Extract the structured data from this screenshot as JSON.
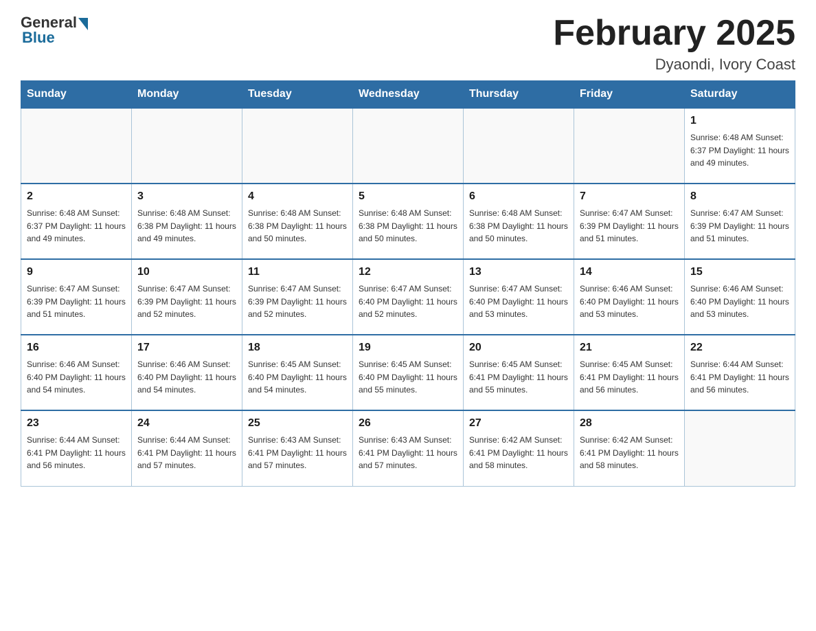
{
  "header": {
    "logo_general": "General",
    "logo_blue": "Blue",
    "title": "February 2025",
    "subtitle": "Dyaondi, Ivory Coast"
  },
  "days_of_week": [
    "Sunday",
    "Monday",
    "Tuesday",
    "Wednesday",
    "Thursday",
    "Friday",
    "Saturday"
  ],
  "weeks": [
    [
      {
        "day": "",
        "info": ""
      },
      {
        "day": "",
        "info": ""
      },
      {
        "day": "",
        "info": ""
      },
      {
        "day": "",
        "info": ""
      },
      {
        "day": "",
        "info": ""
      },
      {
        "day": "",
        "info": ""
      },
      {
        "day": "1",
        "info": "Sunrise: 6:48 AM\nSunset: 6:37 PM\nDaylight: 11 hours\nand 49 minutes."
      }
    ],
    [
      {
        "day": "2",
        "info": "Sunrise: 6:48 AM\nSunset: 6:37 PM\nDaylight: 11 hours\nand 49 minutes."
      },
      {
        "day": "3",
        "info": "Sunrise: 6:48 AM\nSunset: 6:38 PM\nDaylight: 11 hours\nand 49 minutes."
      },
      {
        "day": "4",
        "info": "Sunrise: 6:48 AM\nSunset: 6:38 PM\nDaylight: 11 hours\nand 50 minutes."
      },
      {
        "day": "5",
        "info": "Sunrise: 6:48 AM\nSunset: 6:38 PM\nDaylight: 11 hours\nand 50 minutes."
      },
      {
        "day": "6",
        "info": "Sunrise: 6:48 AM\nSunset: 6:38 PM\nDaylight: 11 hours\nand 50 minutes."
      },
      {
        "day": "7",
        "info": "Sunrise: 6:47 AM\nSunset: 6:39 PM\nDaylight: 11 hours\nand 51 minutes."
      },
      {
        "day": "8",
        "info": "Sunrise: 6:47 AM\nSunset: 6:39 PM\nDaylight: 11 hours\nand 51 minutes."
      }
    ],
    [
      {
        "day": "9",
        "info": "Sunrise: 6:47 AM\nSunset: 6:39 PM\nDaylight: 11 hours\nand 51 minutes."
      },
      {
        "day": "10",
        "info": "Sunrise: 6:47 AM\nSunset: 6:39 PM\nDaylight: 11 hours\nand 52 minutes."
      },
      {
        "day": "11",
        "info": "Sunrise: 6:47 AM\nSunset: 6:39 PM\nDaylight: 11 hours\nand 52 minutes."
      },
      {
        "day": "12",
        "info": "Sunrise: 6:47 AM\nSunset: 6:40 PM\nDaylight: 11 hours\nand 52 minutes."
      },
      {
        "day": "13",
        "info": "Sunrise: 6:47 AM\nSunset: 6:40 PM\nDaylight: 11 hours\nand 53 minutes."
      },
      {
        "day": "14",
        "info": "Sunrise: 6:46 AM\nSunset: 6:40 PM\nDaylight: 11 hours\nand 53 minutes."
      },
      {
        "day": "15",
        "info": "Sunrise: 6:46 AM\nSunset: 6:40 PM\nDaylight: 11 hours\nand 53 minutes."
      }
    ],
    [
      {
        "day": "16",
        "info": "Sunrise: 6:46 AM\nSunset: 6:40 PM\nDaylight: 11 hours\nand 54 minutes."
      },
      {
        "day": "17",
        "info": "Sunrise: 6:46 AM\nSunset: 6:40 PM\nDaylight: 11 hours\nand 54 minutes."
      },
      {
        "day": "18",
        "info": "Sunrise: 6:45 AM\nSunset: 6:40 PM\nDaylight: 11 hours\nand 54 minutes."
      },
      {
        "day": "19",
        "info": "Sunrise: 6:45 AM\nSunset: 6:40 PM\nDaylight: 11 hours\nand 55 minutes."
      },
      {
        "day": "20",
        "info": "Sunrise: 6:45 AM\nSunset: 6:41 PM\nDaylight: 11 hours\nand 55 minutes."
      },
      {
        "day": "21",
        "info": "Sunrise: 6:45 AM\nSunset: 6:41 PM\nDaylight: 11 hours\nand 56 minutes."
      },
      {
        "day": "22",
        "info": "Sunrise: 6:44 AM\nSunset: 6:41 PM\nDaylight: 11 hours\nand 56 minutes."
      }
    ],
    [
      {
        "day": "23",
        "info": "Sunrise: 6:44 AM\nSunset: 6:41 PM\nDaylight: 11 hours\nand 56 minutes."
      },
      {
        "day": "24",
        "info": "Sunrise: 6:44 AM\nSunset: 6:41 PM\nDaylight: 11 hours\nand 57 minutes."
      },
      {
        "day": "25",
        "info": "Sunrise: 6:43 AM\nSunset: 6:41 PM\nDaylight: 11 hours\nand 57 minutes."
      },
      {
        "day": "26",
        "info": "Sunrise: 6:43 AM\nSunset: 6:41 PM\nDaylight: 11 hours\nand 57 minutes."
      },
      {
        "day": "27",
        "info": "Sunrise: 6:42 AM\nSunset: 6:41 PM\nDaylight: 11 hours\nand 58 minutes."
      },
      {
        "day": "28",
        "info": "Sunrise: 6:42 AM\nSunset: 6:41 PM\nDaylight: 11 hours\nand 58 minutes."
      },
      {
        "day": "",
        "info": ""
      }
    ]
  ]
}
